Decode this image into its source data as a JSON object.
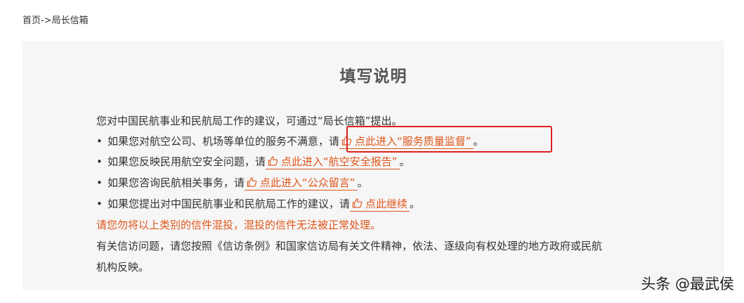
{
  "breadcrumb": {
    "home": "首页",
    "separator": "->",
    "current": "局长信箱"
  },
  "panel": {
    "title": "填写说明",
    "intro": "您对中国民航事业和民航局工作的建议，可通过“局长信箱”提出。",
    "bullet": "•",
    "items": [
      {
        "text": "如果您对航空公司、机场等单位的服务不满意，请",
        "link": "点此进入“服务质量监督”",
        "end": "。"
      },
      {
        "text": "如果您反映民用航空安全问题，请",
        "link": "点此进入“航空安全报告”",
        "end": "。"
      },
      {
        "text": "如果您咨询民航相关事务，请",
        "link": "点此进入“公众留言”",
        "end": "。"
      },
      {
        "text": "如果您提出对中国民航事业和民航局工作的建议，请",
        "link": "点此继续",
        "end": "。"
      }
    ],
    "warning": "请您勿将以上类别的信件混投，混投的信件无法被正常处理。",
    "note_line1": "有关信访问题，请您按照《信访条例》和国家信访局有关文件精神，依法、逐级向有权处理的地方政府或民航",
    "note_line2": "机构反映。"
  },
  "link_icon": "pointing-hand-icon",
  "colors": {
    "link": "#e0561a",
    "warning": "#e0561a",
    "panel_bg": "#f6f6f6",
    "highlight": "#e02020"
  },
  "watermark": "头条 @最武侯"
}
